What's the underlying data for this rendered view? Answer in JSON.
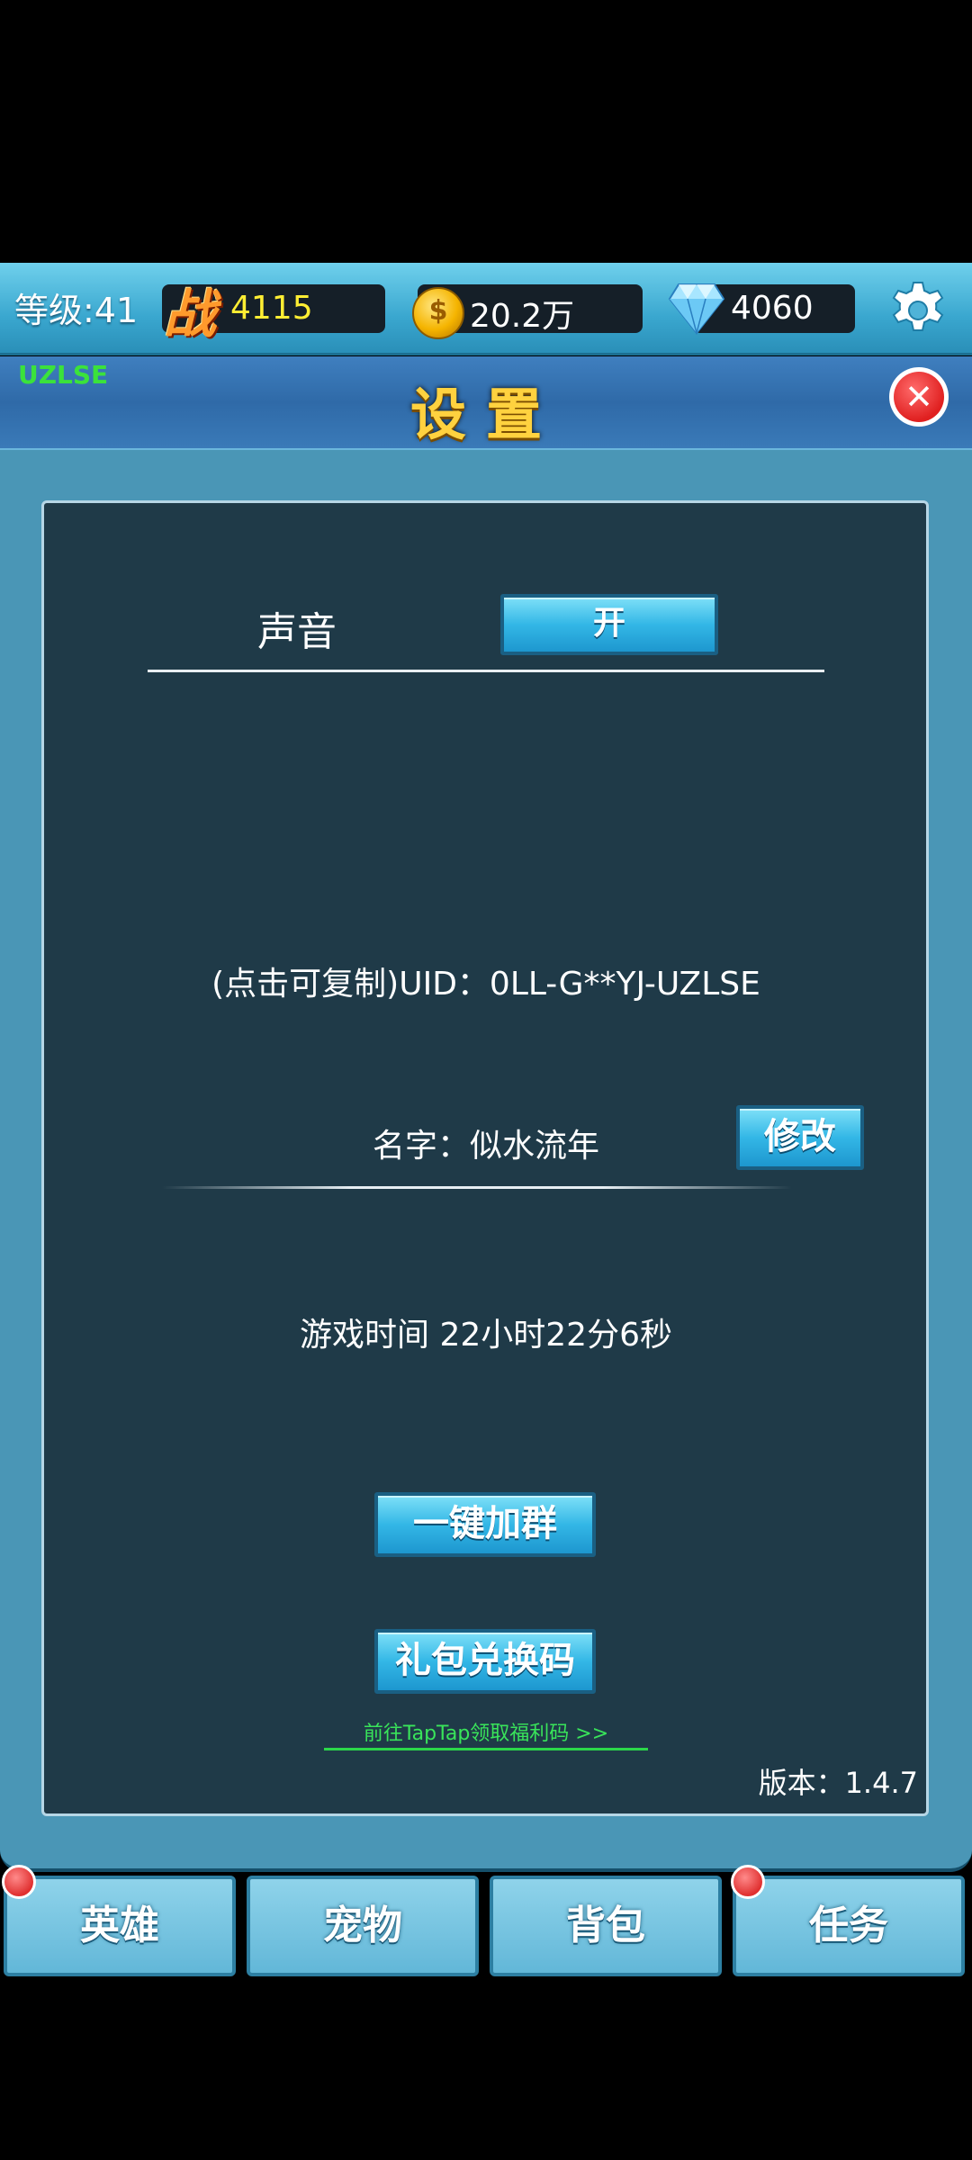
{
  "topbar": {
    "level": "等级:41",
    "power_icon_text": "战",
    "power": "4115",
    "gold": "20.2万",
    "gems": "4060"
  },
  "header": {
    "uid_tag": "UZLSE",
    "title": "设置"
  },
  "settings": {
    "sound_label": "声音",
    "sound_toggle": "开",
    "uid_text": "(点击可复制)UID：0LL-G**YJ-UZLSE",
    "name_text": "名字：似水流年",
    "edit_button": "修改",
    "play_time": "游戏时间 22小时22分6秒",
    "join_group_button": "一键加群",
    "gift_code_button": "礼包兑换码",
    "taptap_link": "前往TapTap领取福利码 >>",
    "version": "版本：1.4.7"
  },
  "tabs": [
    {
      "label": "英雄"
    },
    {
      "label": "宠物"
    },
    {
      "label": "背包"
    },
    {
      "label": "任务"
    }
  ],
  "colors": {
    "accent_title": "#ffd23f",
    "panel_bg": "#1f3a48",
    "link_green": "#39e45a",
    "badge_red": "#e03030"
  }
}
